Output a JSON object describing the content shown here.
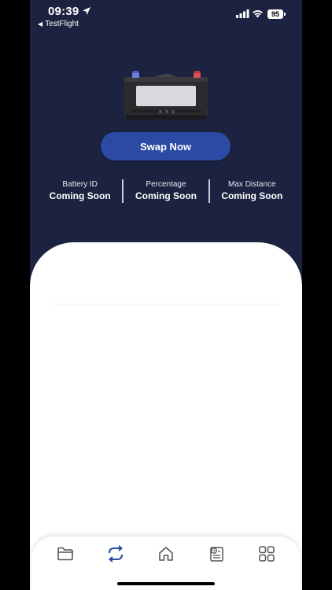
{
  "status_bar": {
    "time": "09:39",
    "back_app": "TestFlight",
    "battery_level": "95",
    "icons": [
      "location-arrow-icon",
      "cellular-signal-icon",
      "wifi-icon",
      "battery-icon"
    ]
  },
  "hero": {
    "image": "car-battery-illustration",
    "swap_button_label": "Swap Now"
  },
  "stats": [
    {
      "label": "Battery ID",
      "value": "Coming Soon"
    },
    {
      "label": "Percentage",
      "value": "Coming Soon"
    },
    {
      "label": "Max Distance",
      "value": "Coming Soon"
    }
  ],
  "tab_bar": {
    "items": [
      {
        "icon": "folder-icon",
        "active": false
      },
      {
        "icon": "swap-icon",
        "active": true
      },
      {
        "icon": "home-icon",
        "active": false
      },
      {
        "icon": "history-document-icon",
        "active": false
      },
      {
        "icon": "grid-menu-icon",
        "active": false
      }
    ]
  },
  "colors": {
    "header_background": "#1c2340",
    "button_blue": "#2a4aa3",
    "active_tab": "#2a4aa3",
    "inactive_tab": "#555555",
    "card_background": "#ffffff"
  }
}
